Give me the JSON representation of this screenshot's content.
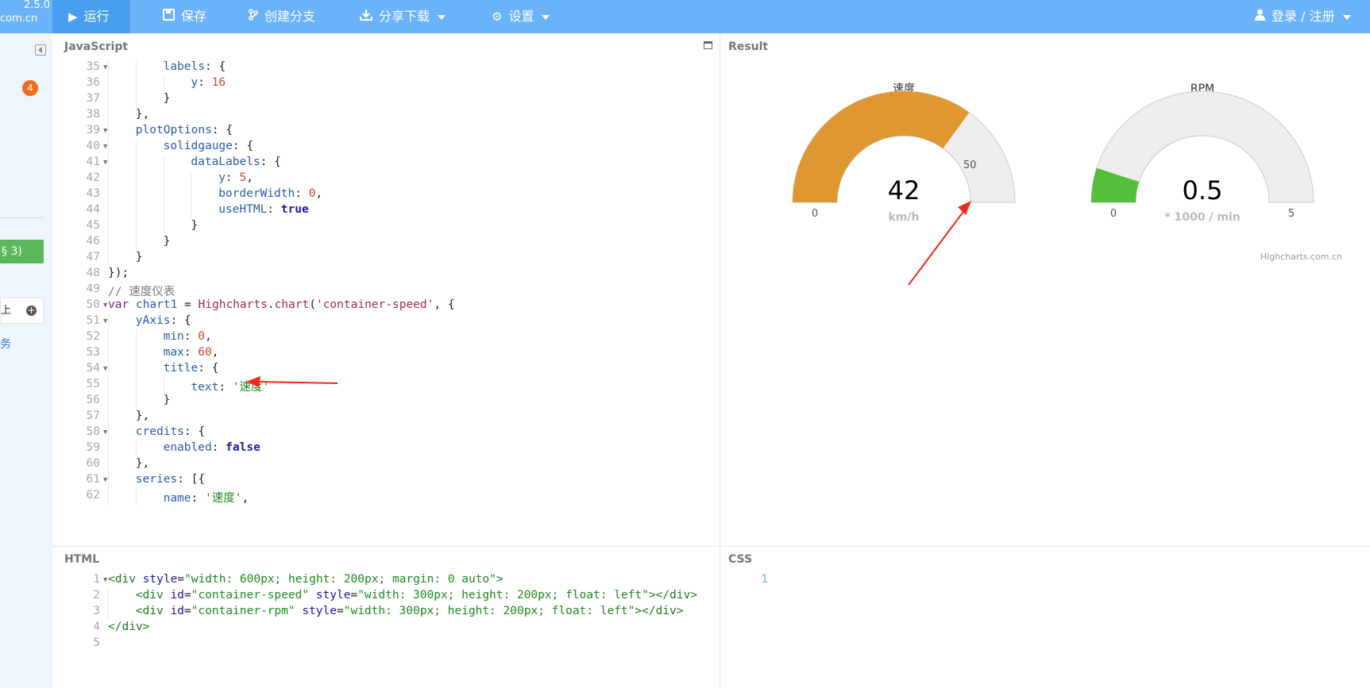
{
  "brand": {
    "version": "2.5.0",
    "domain": "com.cn"
  },
  "toolbar": {
    "run": "运行",
    "save": "保存",
    "fork": "创建分支",
    "share": "分享下载",
    "settings": "设置",
    "login": "登录 / 注册"
  },
  "sidebar": {
    "badge": "4",
    "green_button": "§ 3)",
    "row_label": "上",
    "link": "务"
  },
  "panels": {
    "js": "JavaScript",
    "result": "Result",
    "html": "HTML",
    "css": "CSS"
  },
  "js_lines": [
    {
      "n": "35",
      "fold": true,
      "indent": 2,
      "html": "<span class='k'>labels</span>: {"
    },
    {
      "n": "36",
      "fold": false,
      "indent": 3,
      "html": "<span class='k'>y</span>: <span class='num'>16</span>"
    },
    {
      "n": "37",
      "fold": false,
      "indent": 2,
      "html": "}"
    },
    {
      "n": "38",
      "fold": false,
      "indent": 1,
      "html": "},"
    },
    {
      "n": "39",
      "fold": true,
      "indent": 1,
      "html": "<span class='k'>plotOptions</span>: {"
    },
    {
      "n": "40",
      "fold": true,
      "indent": 2,
      "html": "<span class='k'>solidgauge</span>: {"
    },
    {
      "n": "41",
      "fold": true,
      "indent": 3,
      "html": "<span class='k'>dataLabels</span>: {"
    },
    {
      "n": "42",
      "fold": false,
      "indent": 4,
      "html": "<span class='k'>y</span>: <span class='num'>5</span>,"
    },
    {
      "n": "43",
      "fold": false,
      "indent": 4,
      "html": "<span class='k'>borderWidth</span>: <span class='num'>0</span>,"
    },
    {
      "n": "44",
      "fold": false,
      "indent": 4,
      "html": "<span class='k'>useHTML</span>: <span class='bool'>true</span>"
    },
    {
      "n": "45",
      "fold": false,
      "indent": 3,
      "html": "}"
    },
    {
      "n": "46",
      "fold": false,
      "indent": 2,
      "html": "}"
    },
    {
      "n": "47",
      "fold": false,
      "indent": 1,
      "html": "}"
    },
    {
      "n": "48",
      "fold": false,
      "indent": 0,
      "html": "});"
    },
    {
      "n": "49",
      "fold": false,
      "indent": 0,
      "html": "<span class='cm'>// 速度仪表</span>"
    },
    {
      "n": "50",
      "fold": true,
      "indent": 0,
      "html": "<span class='kw'>var</span> <span class='k'>chart1</span> = <span class='fn'>Highcharts</span>.<span class='fn'>chart</span>(<span class='fn'>'container-speed'</span>, {"
    },
    {
      "n": "51",
      "fold": true,
      "indent": 1,
      "html": "<span class='k'>yAxis</span>: {"
    },
    {
      "n": "52",
      "fold": false,
      "indent": 2,
      "html": "<span class='k'>min</span>: <span class='num'>0</span>,"
    },
    {
      "n": "53",
      "fold": false,
      "indent": 2,
      "html": "<span class='k'>max</span>: <span class='num'>60</span>,"
    },
    {
      "n": "54",
      "fold": true,
      "indent": 2,
      "html": "<span class='k'>title</span>: {"
    },
    {
      "n": "55",
      "fold": false,
      "indent": 3,
      "html": "<span class='k'>text</span>: <span class='str'>'速度'</span>"
    },
    {
      "n": "56",
      "fold": false,
      "indent": 2,
      "html": "}"
    },
    {
      "n": "57",
      "fold": false,
      "indent": 1,
      "html": "},"
    },
    {
      "n": "58",
      "fold": true,
      "indent": 1,
      "html": "<span class='k'>credits</span>: {"
    },
    {
      "n": "59",
      "fold": false,
      "indent": 2,
      "html": "<span class='k'>enabled</span>: <span class='bool'>false</span>"
    },
    {
      "n": "60",
      "fold": false,
      "indent": 1,
      "html": "},"
    },
    {
      "n": "61",
      "fold": true,
      "indent": 1,
      "html": "<span class='k'>series</span>: [{"
    },
    {
      "n": "62",
      "fold": false,
      "indent": 2,
      "html": "<span class='k'>name</span>: <span class='str'>'速度'</span>,"
    }
  ],
  "html_lines": [
    {
      "n": "1",
      "fold": true,
      "indent": 0,
      "html": "<span class='tag'>&lt;div</span> <span class='attr'>style</span>=<span class='aval'>\"width: 600px; height: 200px; margin: 0 auto\"</span><span class='tag'>&gt;</span>"
    },
    {
      "n": "2",
      "fold": false,
      "indent": 1,
      "html": "<span class='tag'>&lt;div</span> <span class='attr'>id</span>=<span class='aval'>\"container-speed\"</span> <span class='attr'>style</span>=<span class='aval'>\"width: 300px; height: 200px; float: left\"</span><span class='tag'>&gt;&lt;/div&gt;</span>"
    },
    {
      "n": "3",
      "fold": false,
      "indent": 1,
      "html": "<span class='tag'>&lt;div</span> <span class='attr'>id</span>=<span class='aval'>\"container-rpm\"</span> <span class='attr'>style</span>=<span class='aval'>\"width: 300px; height: 200px; float: left\"</span><span class='tag'>&gt;&lt;/div&gt;</span>"
    },
    {
      "n": "4",
      "fold": false,
      "indent": 0,
      "html": "<span class='tag'>&lt;/div&gt;</span>"
    },
    {
      "n": "5",
      "fold": false,
      "indent": 0,
      "html": ""
    }
  ],
  "css_lines": [
    {
      "n": "1",
      "html": ""
    }
  ],
  "gauges": {
    "speed": {
      "title": "速度",
      "min": 0,
      "max": 60,
      "value": 42,
      "min_label": "0",
      "tick_label": "50",
      "tick_value": 50,
      "value_label": "42",
      "unit": "km/h",
      "color": "#df9831",
      "track": "#eeeeee"
    },
    "rpm": {
      "title": "RPM",
      "min": 0,
      "max": 5,
      "value": 0.5,
      "min_label": "0",
      "max_label": "5",
      "value_label": "0.5",
      "unit": "* 1000 / min",
      "color": "#55bf3b",
      "track": "#eeeeee"
    },
    "credits": "Highcharts.com.cn"
  },
  "annotation_color": "#f02a1c"
}
